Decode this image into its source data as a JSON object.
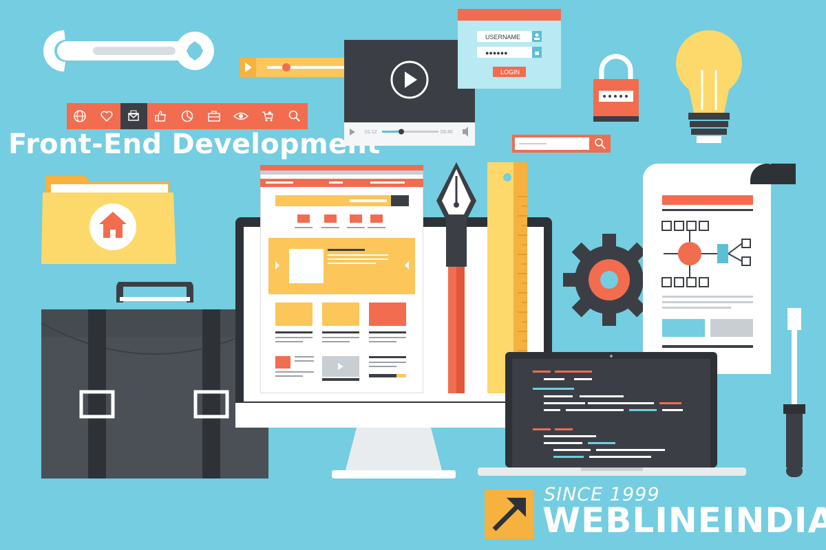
{
  "headline": "Front-End Development",
  "brand": {
    "since": "SINCE 1999",
    "name": "WEBLINEINDIA"
  },
  "login_form": {
    "username_placeholder": "USERNAME",
    "password_mask": "●●●●●●",
    "login_label": "LOGIN"
  },
  "video_player": {
    "time_elapsed": "01:12",
    "time_total": "03:40"
  },
  "icon_toolbar": {
    "icons": [
      "globe-icon",
      "heart-icon",
      "mail-icon",
      "thumbs-up-icon",
      "pie-chart-icon",
      "briefcase-icon",
      "eye-icon",
      "cart-icon",
      "search-icon"
    ]
  },
  "colors": {
    "background": "#74cde0",
    "accent_orange": "#f26c4f",
    "accent_yellow": "#fcc65a",
    "dark": "#3b3f45",
    "light": "#ffffff"
  }
}
